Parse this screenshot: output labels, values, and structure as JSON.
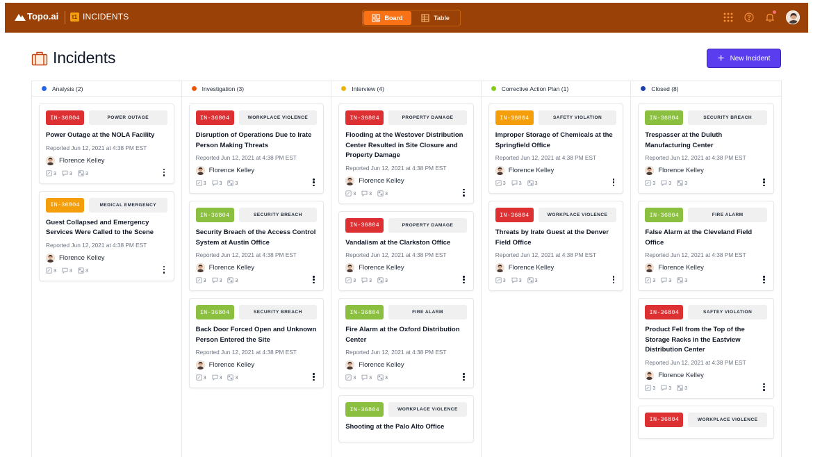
{
  "app": {
    "brand": "Topo.ai",
    "module_badge": "t1",
    "module": "INCIDENTS",
    "views": [
      {
        "label": "Board",
        "active": true
      },
      {
        "label": "Table",
        "active": false
      }
    ],
    "icons": [
      "apps-grid-icon",
      "help-icon",
      "bell-icon",
      "user-avatar"
    ]
  },
  "page": {
    "title": "Incidents",
    "new_button": "New Incident"
  },
  "colors": {
    "red": "#dc3033",
    "orange": "#f59e0b",
    "green": "#8bbf3f",
    "dot_analysis": "#2563eb",
    "dot_investigation": "#ea580c",
    "dot_interview": "#eab308",
    "dot_corrective": "#84cc16",
    "dot_closed": "#1e40af",
    "accent": "#5b3df0"
  },
  "columns": [
    {
      "label": "Analysis (2)",
      "dot": "#2563eb",
      "cards": [
        {
          "id": "IN-36804",
          "id_color": "#dc3033",
          "category": "POWER OUTAGE",
          "title": "Power Outage at the NOLA Facility",
          "reported": "Reported Jun 12, 2021 at 4:38 PM EST",
          "user": "Florence Kelley",
          "attachments": "3",
          "comments": "3",
          "tasks": "3"
        },
        {
          "id": "IN-36804",
          "id_color": "#f59e0b",
          "category": "MEDICAL EMERGENCY",
          "title": "Guest Collapsed and Emergency Services Were Called to the Scene",
          "reported": "Reported Jun 12, 2021 at 4:38 PM EST",
          "user": "Florence Kelley",
          "attachments": "3",
          "comments": "3",
          "tasks": "3"
        }
      ]
    },
    {
      "label": "Investigation (3)",
      "dot": "#ea580c",
      "cards": [
        {
          "id": "IN-36804",
          "id_color": "#dc3033",
          "category": "WORKPLACE VIOLENCE",
          "title": "Disruption of Operations Due to Irate Person Making Threats",
          "reported": "Reported Jun 12, 2021 at 4:38 PM EST",
          "user": "Florence Kelley",
          "attachments": "3",
          "comments": "3",
          "tasks": "3"
        },
        {
          "id": "IN-36804",
          "id_color": "#8bbf3f",
          "category": "SECURITY BREACH",
          "title": "Security Breach of the Access Control System at Austin Office",
          "reported": "Reported Jun 12, 2021 at 4:38 PM EST",
          "user": "Florence Kelley",
          "attachments": "3",
          "comments": "3",
          "tasks": "3"
        },
        {
          "id": "IN-36804",
          "id_color": "#8bbf3f",
          "category": "SECURITY BREACH",
          "title": "Back Door Forced Open and Unknown Person Entered the Site",
          "reported": "Reported Jun 12, 2021 at 4:38 PM EST",
          "user": "Florence Kelley",
          "attachments": "3",
          "comments": "3",
          "tasks": "3"
        }
      ]
    },
    {
      "label": "Interview (4)",
      "dot": "#eab308",
      "cards": [
        {
          "id": "IN-36804",
          "id_color": "#dc3033",
          "category": "PROPERTY DAMAGE",
          "title": "Flooding at the Westover Distribution Center Resulted in Site Closure and Property Damage",
          "reported": "Reported Jun 12, 2021 at 4:38 PM EST",
          "user": "Florence Kelley",
          "attachments": "3",
          "comments": "3",
          "tasks": "3"
        },
        {
          "id": "IN-36804",
          "id_color": "#dc3033",
          "category": "PROPERTY DAMAGE",
          "title": "Vandalism at the Clarkston Office",
          "reported": "Reported Jun 12, 2021 at 4:38 PM EST",
          "user": "Florence Kelley",
          "attachments": "3",
          "comments": "3",
          "tasks": "3"
        },
        {
          "id": "IN-36804",
          "id_color": "#8bbf3f",
          "category": "FIRE ALARM",
          "title": "Fire Alarm at the Oxford Distribution Center",
          "reported": "Reported Jun 12, 2021 at 4:38 PM EST",
          "user": "Florence Kelley",
          "attachments": "3",
          "comments": "3",
          "tasks": "3"
        },
        {
          "id": "IN-36804",
          "id_color": "#8bbf3f",
          "category": "WORKPLACE VIOLENCE",
          "title": "Shooting at the Palo Alto Office",
          "reported": "",
          "user": "",
          "attachments": "",
          "comments": "",
          "tasks": ""
        }
      ]
    },
    {
      "label": "Corrective Action Plan (1)",
      "dot": "#84cc16",
      "cards": [
        {
          "id": "IN-36804",
          "id_color": "#f59e0b",
          "category": "SAFETY VIOLATION",
          "title": "Improper Storage of Chemicals at the Springfield Office",
          "reported": "Reported Jun 12, 2021 at 4:38 PM EST",
          "user": "Florence Kelley",
          "attachments": "3",
          "comments": "3",
          "tasks": "3"
        },
        {
          "id": "IN-36804",
          "id_color": "#dc3033",
          "category": "WORKPLACE VIOLENCE",
          "title": "Threats by Irate Guest at the Denver Field Office",
          "reported": "Reported Jun 12, 2021 at 4:38 PM EST",
          "user": "Florence Kelley",
          "attachments": "3",
          "comments": "3",
          "tasks": "3"
        }
      ]
    },
    {
      "label": "Closed (8)",
      "dot": "#1e40af",
      "cards": [
        {
          "id": "IN-36804",
          "id_color": "#8bbf3f",
          "category": "SECURITY BREACH",
          "title": "Trespasser at the Duluth Manufacturing Center",
          "reported": "Reported Jun 12, 2021 at 4:38 PM EST",
          "user": "Florence Kelley",
          "attachments": "3",
          "comments": "3",
          "tasks": "3"
        },
        {
          "id": "IN-36804",
          "id_color": "#8bbf3f",
          "category": "FIRE ALARM",
          "title": "False Alarm at the Cleveland Field Office",
          "reported": "Reported Jun 12, 2021 at 4:38 PM EST",
          "user": "Florence Kelley",
          "attachments": "3",
          "comments": "3",
          "tasks": "3"
        },
        {
          "id": "IN-36804",
          "id_color": "#dc3033",
          "category": "SAFTEY VIOLATION",
          "title": "Product Fell from the Top of the Storage Racks in the Eastview Distribution Center",
          "reported": "Reported Jun 12, 2021 at 4:38 PM EST",
          "user": "Florence Kelley",
          "attachments": "3",
          "comments": "3",
          "tasks": "3"
        },
        {
          "id": "IN-36804",
          "id_color": "#dc3033",
          "category": "WORKPLACE VIOLENCE",
          "title": "",
          "reported": "",
          "user": "",
          "attachments": "",
          "comments": "",
          "tasks": ""
        }
      ]
    }
  ]
}
